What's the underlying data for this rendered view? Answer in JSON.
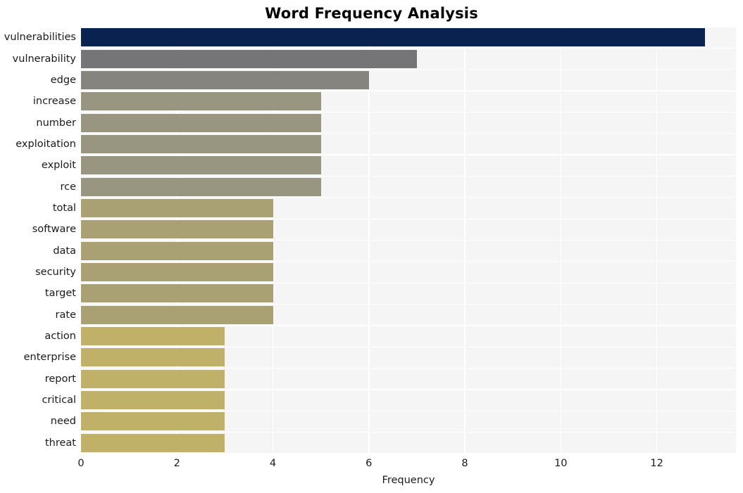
{
  "chart_data": {
    "type": "bar",
    "orientation": "horizontal",
    "title": "Word Frequency Analysis",
    "xlabel": "Frequency",
    "ylabel": "",
    "xlim": [
      0,
      13.65
    ],
    "xticks": [
      0,
      2,
      4,
      6,
      8,
      10,
      12
    ],
    "grid": true,
    "legend": null,
    "categories": [
      "vulnerabilities",
      "vulnerability",
      "edge",
      "increase",
      "number",
      "exploitation",
      "exploit",
      "rce",
      "total",
      "software",
      "data",
      "security",
      "target",
      "rate",
      "action",
      "enterprise",
      "report",
      "critical",
      "need",
      "threat"
    ],
    "values": [
      13,
      7,
      6,
      5,
      5,
      5,
      5,
      5,
      4,
      4,
      4,
      4,
      4,
      4,
      3,
      3,
      3,
      3,
      3,
      3
    ],
    "bar_colors": [
      "#0a2250",
      "#757578",
      "#86847e",
      "#989581",
      "#989581",
      "#989581",
      "#989581",
      "#989581",
      "#a9a173",
      "#a9a173",
      "#a9a173",
      "#a9a173",
      "#a9a173",
      "#a9a173",
      "#bfb167",
      "#bfb167",
      "#bfb167",
      "#bfb167",
      "#bfb167",
      "#bfb167"
    ],
    "plot_background": "#f5f5f6",
    "grid_color": "#ffffff",
    "figure_background": "#ffffff",
    "text_color": "#1a1a1a"
  }
}
